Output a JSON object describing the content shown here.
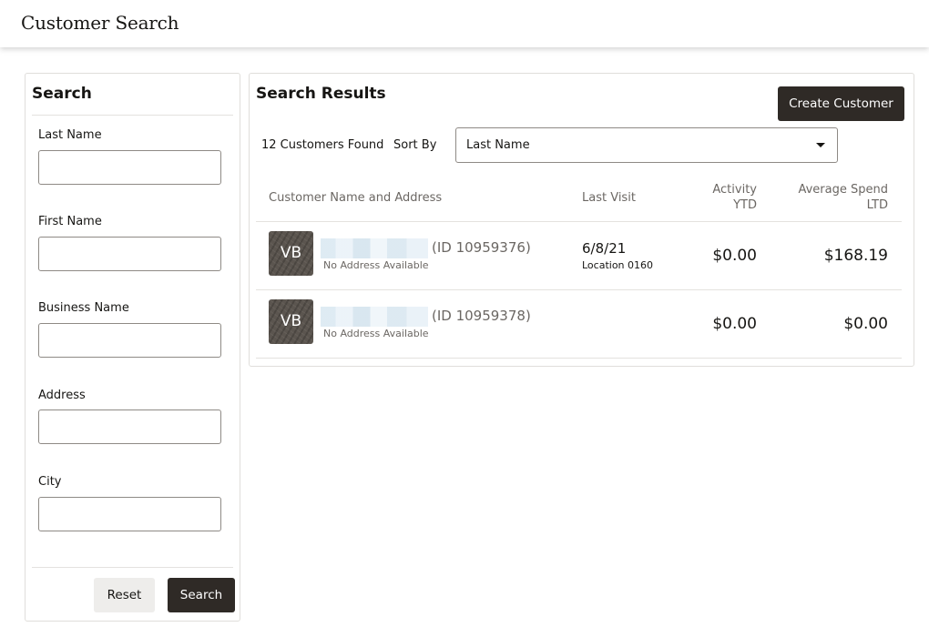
{
  "header": {
    "title": "Customer Search"
  },
  "search_panel": {
    "title": "Search",
    "fields": [
      {
        "label": "Last Name",
        "value": ""
      },
      {
        "label": "First Name",
        "value": ""
      },
      {
        "label": "Business Name",
        "value": ""
      },
      {
        "label": "Address",
        "value": ""
      },
      {
        "label": "City",
        "value": ""
      }
    ],
    "reset_label": "Reset",
    "search_label": "Search"
  },
  "results": {
    "title": "Search Results",
    "create_label": "Create Customer",
    "count_label": "12 Customers Found",
    "sort_label": "Sort By",
    "sort_value": "Last Name",
    "columns": {
      "name": "Customer Name and Address",
      "last_visit": "Last Visit",
      "activity_line1": "Activity",
      "activity_line2": "YTD",
      "spend_line1": "Average Spend",
      "spend_line2": "LTD"
    },
    "rows": [
      {
        "initials": "VB",
        "id_text": "(ID 10959376)",
        "address": "No Address Available",
        "visit_date": "6/8/21",
        "visit_location": "Location 0160",
        "activity": "$0.00",
        "spend": "$168.19"
      },
      {
        "initials": "VB",
        "id_text": "(ID 10959378)",
        "address": "No Address Available",
        "visit_date": "",
        "visit_location": "",
        "activity": "$0.00",
        "spend": "$0.00"
      }
    ]
  },
  "colors": {
    "primary_button": "#2f2a26",
    "secondary_button": "#eeedeb",
    "border": "#e0dedb"
  }
}
